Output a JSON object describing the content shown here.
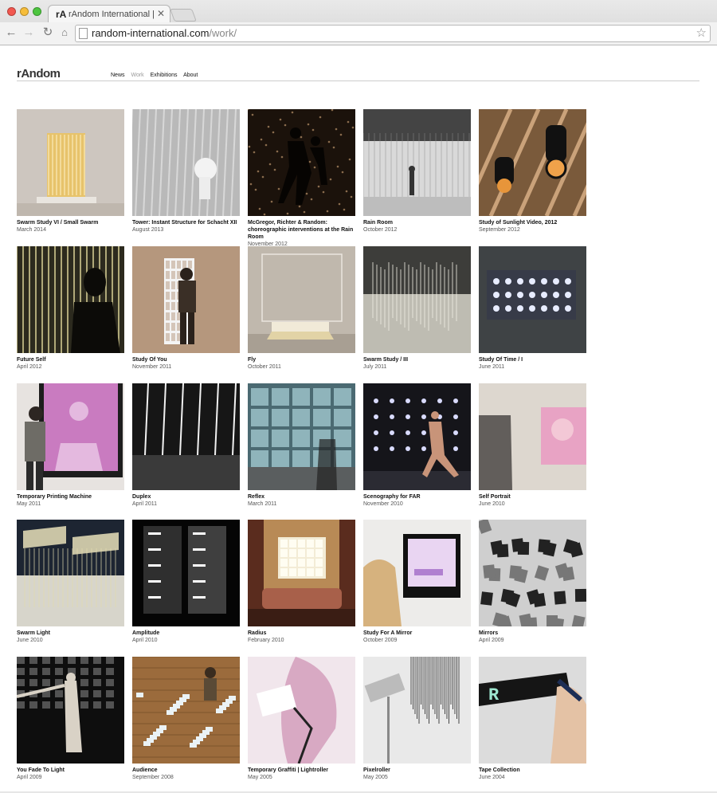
{
  "browser": {
    "tab_title": "rAndom International | rA",
    "tab_favicon": "rA",
    "url_host": "random-international.com",
    "url_path": "/work/"
  },
  "site": {
    "logo": "rAndom",
    "nav": [
      "News",
      "Work",
      "Exhibitions",
      "About"
    ],
    "active_nav": "Work"
  },
  "works": [
    {
      "title": "Swarm Study VI / Small Swarm",
      "date": "March 2014"
    },
    {
      "title": "Tower: Instant Structure for Schacht XII",
      "date": "August 2013"
    },
    {
      "title": "McGregor, Richter & Random: choreographic interventions at the Rain Room",
      "date": "November 2012"
    },
    {
      "title": "Rain Room",
      "date": "October 2012"
    },
    {
      "title": "Study of Sunlight Video, 2012",
      "date": "September 2012"
    },
    {
      "title": "Future Self",
      "date": "April 2012"
    },
    {
      "title": "Study Of You",
      "date": "November 2011"
    },
    {
      "title": "Fly",
      "date": "October 2011"
    },
    {
      "title": "Swarm Study / III",
      "date": "July 2011"
    },
    {
      "title": "Study Of Time / I",
      "date": "June 2011"
    },
    {
      "title": "Temporary Printing Machine",
      "date": "May 2011"
    },
    {
      "title": "Duplex",
      "date": "April 2011"
    },
    {
      "title": "Reflex",
      "date": "March 2011"
    },
    {
      "title": "Scenography for FAR",
      "date": "November 2010"
    },
    {
      "title": "Self Portrait",
      "date": "June 2010"
    },
    {
      "title": "Swarm Light",
      "date": "June 2010"
    },
    {
      "title": "Amplitude",
      "date": "April 2010"
    },
    {
      "title": "Radius",
      "date": "February 2010"
    },
    {
      "title": "Study For A Mirror",
      "date": "October 2009"
    },
    {
      "title": "Mirrors",
      "date": "April 2009"
    },
    {
      "title": "You Fade To Light",
      "date": "April 2009"
    },
    {
      "title": "Audience",
      "date": "September 2008"
    },
    {
      "title": "Temporary Graffiti | Lightroller",
      "date": "May 2005"
    },
    {
      "title": "Pixelroller",
      "date": "May 2005"
    },
    {
      "title": "Tape Collection",
      "date": "June 2004"
    }
  ],
  "colors": {
    "title_text": "#111111",
    "date_text": "#555555",
    "nav_active": "#999999",
    "rule": "#cccccc"
  }
}
